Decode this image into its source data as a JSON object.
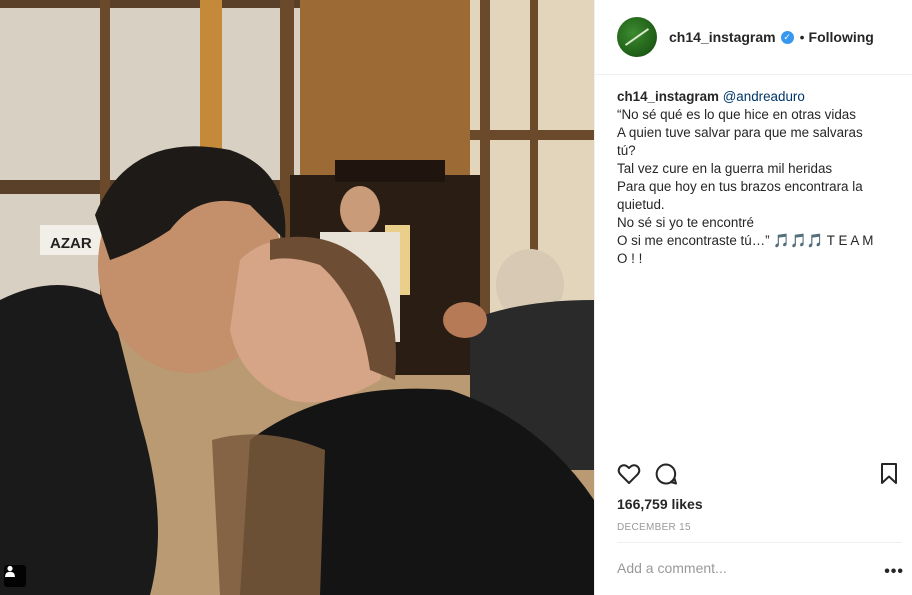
{
  "header": {
    "username": "ch14_instagram",
    "separator": "•",
    "follow_status": "Following",
    "verified_symbol": "✓"
  },
  "caption": {
    "username": "ch14_instagram",
    "mention": "@andreaduro",
    "lines": [
      "“No sé qué es lo que hice en otras vidas",
      "A quien tuve salvar para que me salvaras",
      "tú?",
      "Tal vez cure en la guerra mil heridas",
      "Para que hoy en tus brazos encontrara la",
      "quietud.",
      "No sé si yo te encontré"
    ],
    "last_line_text": "O si me encontraste tú…”",
    "last_line_emoji": "🎵🎵🎵",
    "last_line_tail": " T E A M",
    "final_line": "O ! !"
  },
  "likes_text": "166,759 likes",
  "date_text": "DECEMBER 15",
  "comment": {
    "placeholder": "Add a comment..."
  },
  "more_label": "•••",
  "icons": {
    "like": "heart-icon",
    "comment": "comment-icon",
    "save": "bookmark-icon",
    "tag": "user-tag-icon"
  },
  "colors": {
    "verified": "#3897f0",
    "mention": "#003569",
    "muted": "#999999",
    "text": "#262626"
  }
}
